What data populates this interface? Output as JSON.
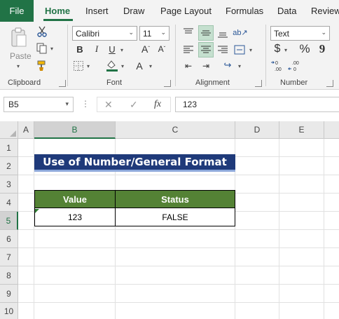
{
  "ribbon": {
    "tabs": [
      "File",
      "Home",
      "Insert",
      "Draw",
      "Page Layout",
      "Formulas",
      "Data",
      "Review"
    ],
    "active_tab": "Home",
    "clipboard": {
      "paste_label": "Paste",
      "group_label": "Clipboard"
    },
    "font": {
      "name": "Calibri",
      "size": "11",
      "group_label": "Font",
      "bold": "B",
      "italic": "I",
      "underline": "U",
      "grow": "A^",
      "shrink": "A˅"
    },
    "alignment": {
      "group_label": "Alignment"
    },
    "number": {
      "format": "Text",
      "group_label": "Number",
      "currency": "$",
      "percent": "%",
      "comma": "9"
    }
  },
  "formula_bar": {
    "name_box": "B5",
    "fx_label": "fx",
    "value": "123"
  },
  "grid": {
    "columns": [
      "A",
      "B",
      "C",
      "D",
      "E"
    ],
    "rows": [
      "1",
      "2",
      "3",
      "4",
      "5",
      "6",
      "7",
      "8",
      "9",
      "10"
    ],
    "selected_column": "B",
    "selected_row": "5"
  },
  "sheet": {
    "title": "Use of Number/General Format",
    "headers": [
      "Value",
      "Status"
    ],
    "row": {
      "value": "123",
      "status": "FALSE"
    }
  },
  "colors": {
    "accent": "#217346",
    "title_fill": "#1f3a7a",
    "header_fill": "#548235"
  }
}
